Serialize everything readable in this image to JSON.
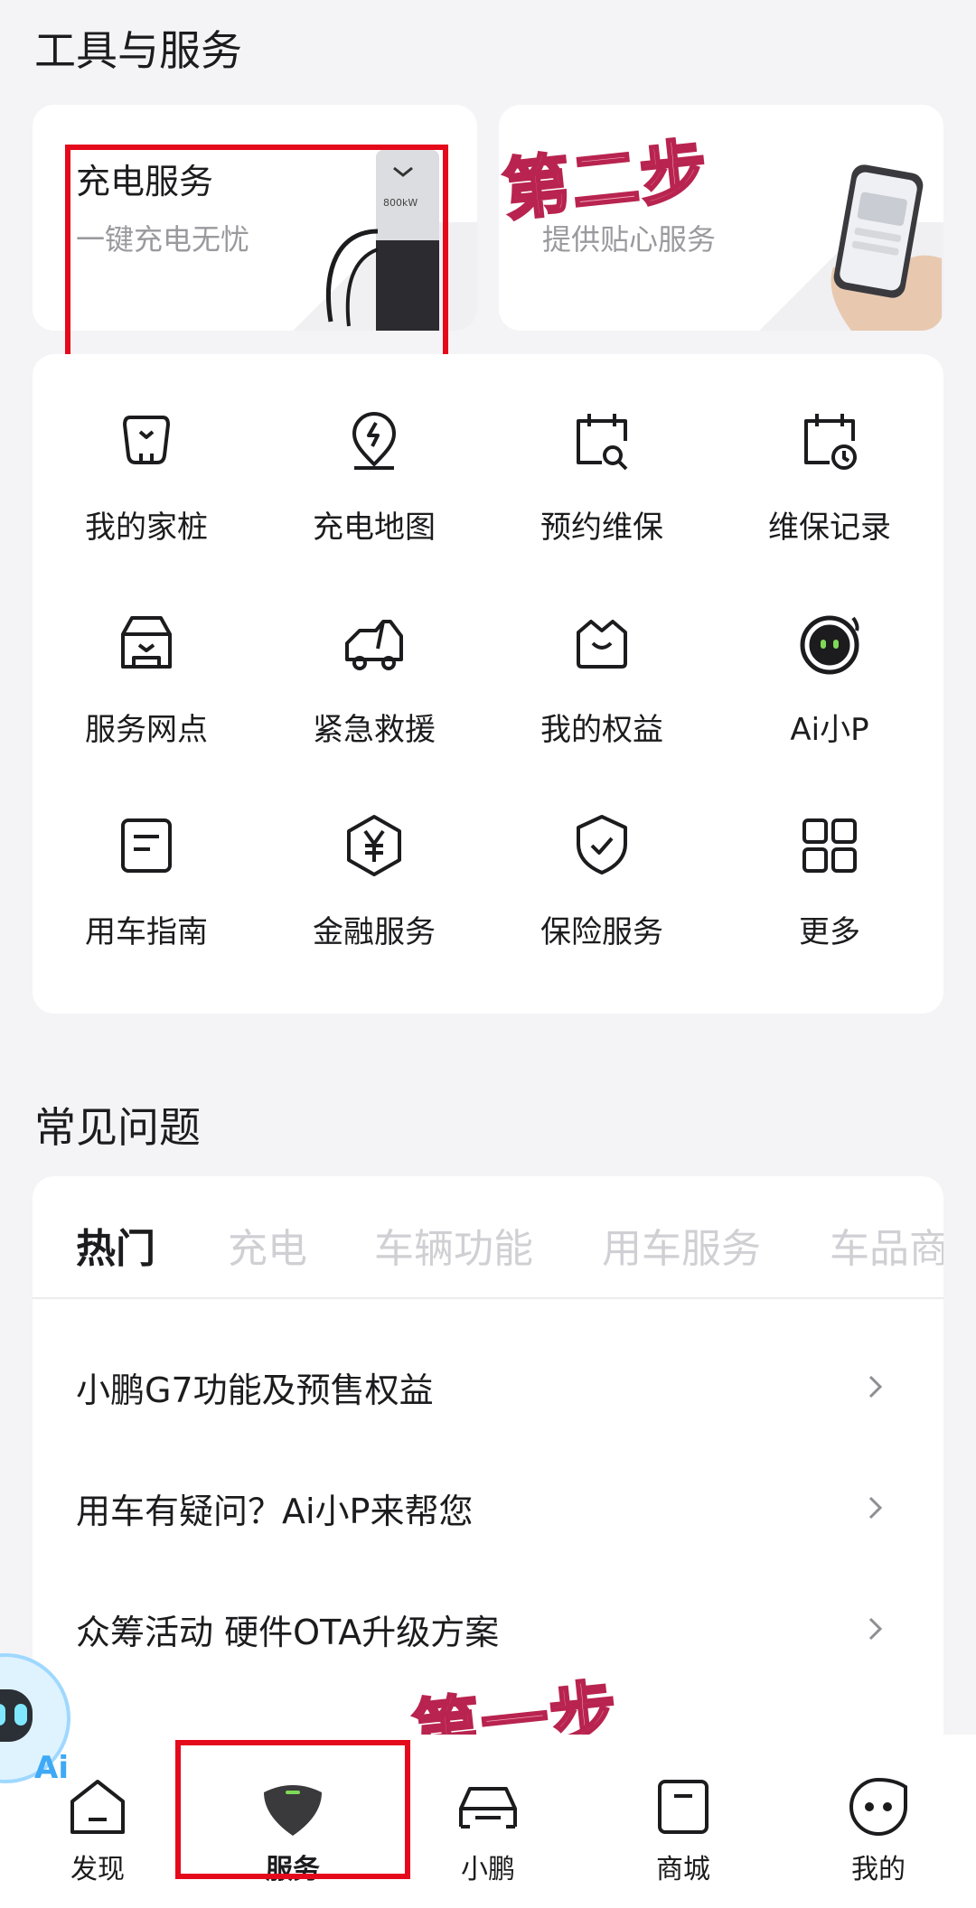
{
  "tools_section": {
    "title": "工具与服务"
  },
  "promo_cards": [
    {
      "title": "充电服务",
      "subtitle": "一键充电无忧"
    },
    {
      "title": "",
      "subtitle": "提供贴心服务"
    }
  ],
  "annotations": {
    "step1": "第一步",
    "step2": "第二步"
  },
  "grid_items": [
    {
      "label": "我的家桩",
      "icon": "home-charger-icon"
    },
    {
      "label": "充电地图",
      "icon": "charging-map-pin-icon"
    },
    {
      "label": "预约维保",
      "icon": "calendar-search-icon"
    },
    {
      "label": "维保记录",
      "icon": "calendar-clock-icon"
    },
    {
      "label": "服务网点",
      "icon": "service-store-icon"
    },
    {
      "label": "紧急救援",
      "icon": "tow-truck-icon"
    },
    {
      "label": "我的权益",
      "icon": "crown-basket-icon"
    },
    {
      "label": "Ai小P",
      "icon": "ai-assistant-icon"
    },
    {
      "label": "用车指南",
      "icon": "guide-document-icon"
    },
    {
      "label": "金融服务",
      "icon": "yuan-hexagon-icon"
    },
    {
      "label": "保险服务",
      "icon": "shield-check-icon"
    },
    {
      "label": "更多",
      "icon": "grid-more-icon"
    }
  ],
  "faq_section": {
    "title": "常见问题",
    "tabs": [
      "热门",
      "充电",
      "车辆功能",
      "用车服务",
      "车品商"
    ],
    "active_tab": "热门",
    "items": [
      {
        "text": "小鹏G7功能及预售权益"
      },
      {
        "text": "用车有疑问？Ai小P来帮您"
      },
      {
        "text": "众筹活动 硬件OTA升级方案"
      }
    ]
  },
  "bottom_nav": {
    "items": [
      {
        "label": "发现",
        "icon": "discover-house-icon"
      },
      {
        "label": "服务",
        "icon": "service-icon"
      },
      {
        "label": "小鹏",
        "icon": "car-icon"
      },
      {
        "label": "商城",
        "icon": "shopping-bag-icon"
      },
      {
        "label": "我的",
        "icon": "profile-face-icon"
      }
    ],
    "active": "服务"
  },
  "assistant_badge": "Ai",
  "colors": {
    "annotation_red": "#e5091c",
    "accent_green": "#7ed957",
    "step_pink": "#f5a6bd"
  }
}
